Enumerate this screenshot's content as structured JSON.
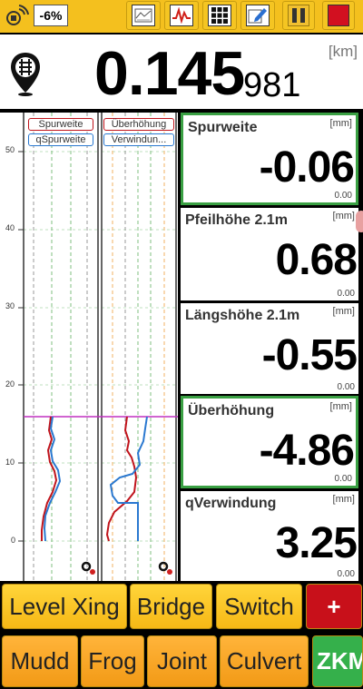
{
  "top": {
    "percent": "-6%",
    "icons": [
      "satellite-icon",
      "chart-report-icon",
      "graph-icon",
      "grid-icon",
      "edit-icon",
      "pause-icon",
      "stop-icon"
    ]
  },
  "position": {
    "unit": "[km]",
    "value_main": "0.145",
    "value_fine": "981"
  },
  "chart": {
    "left_legend": [
      "Spurweite",
      "qSpurweite"
    ],
    "right_legend": [
      "Überhöhung",
      "Verwindun..."
    ],
    "y_ticks": [
      "50",
      "40",
      "30",
      "20",
      "10",
      "0"
    ]
  },
  "panels": [
    {
      "title": "Spurweite",
      "unit": "[mm]",
      "value": "-0.06",
      "zero": "0.00",
      "highlight": true
    },
    {
      "title": "Pfeilhöhe 2.1m",
      "unit": "[mm]",
      "value": "0.68",
      "zero": "0.00",
      "highlight": false
    },
    {
      "title": "Längshöhe 2.1m",
      "unit": "[mm]",
      "value": "-0.55",
      "zero": "0.00",
      "highlight": false
    },
    {
      "title": "Überhöhung",
      "unit": "[mm]",
      "value": "-4.86",
      "zero": "0.00",
      "highlight": true
    },
    {
      "title": "qVerwindung",
      "unit": "[mm]",
      "value": "3.25",
      "zero": "0.00",
      "highlight": false
    }
  ],
  "buttons_row1": [
    "Level Xing",
    "Bridge",
    "Switch",
    "+"
  ],
  "buttons_row2": [
    "Mudd",
    "Frog",
    "Joint",
    "Culvert",
    "ZKM"
  ],
  "colors": {
    "accent": "#f4c01e",
    "green": "#3aa043",
    "red": "#c8101a"
  }
}
